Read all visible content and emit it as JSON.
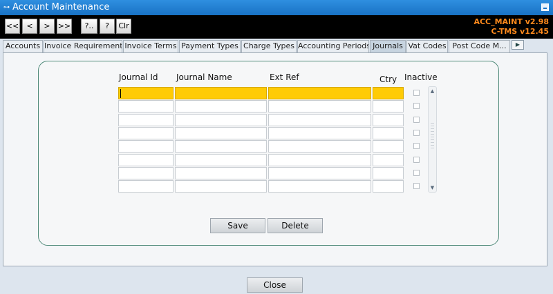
{
  "window": {
    "title": "Account Maintenance"
  },
  "toolbar": {
    "first": "<<",
    "prev": "<",
    "next": ">",
    "last": ">>",
    "query": "?..",
    "help": "?",
    "clear": "Clr"
  },
  "version": {
    "line1": "ACC_MAINT v2.98",
    "line2": "C-TMS v12.45"
  },
  "tabs": [
    "Accounts",
    "Invoice Requirements",
    "Invoice Terms",
    "Payment Types",
    "Charge Types",
    "Accounting Periods",
    "Journals",
    "Vat Codes",
    "Post Code M..."
  ],
  "active_tab": "Journals",
  "table": {
    "columns": [
      "Journal Id",
      "Journal Name",
      "Ext Ref",
      "Ctry",
      "Inactive"
    ],
    "row_count": 8
  },
  "buttons": {
    "save": "Save",
    "delete": "Delete",
    "close": "Close"
  },
  "colors": {
    "selected_row": "#ffcb05",
    "version_text": "#ff8a1c",
    "title_bar": "#1f7fd4"
  }
}
